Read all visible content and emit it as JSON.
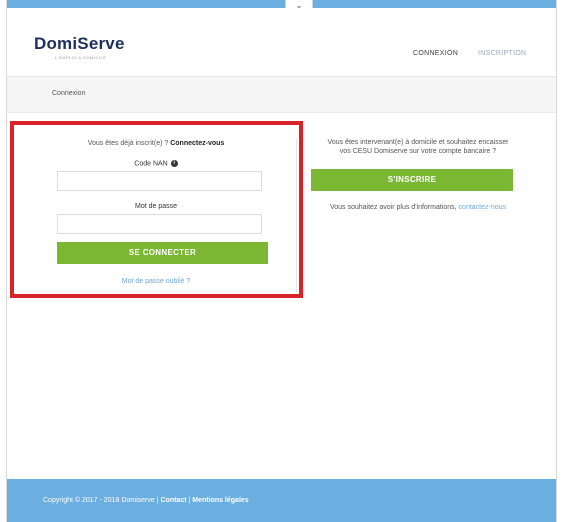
{
  "header": {
    "logo_main": "DomiServe",
    "logo_tagline": "L'EMPLOI A DOMICILE",
    "nav": {
      "connexion": "CONNEXION",
      "inscription": "INSCRIPTION"
    },
    "toggle_glyph": "⌄"
  },
  "subbar": {
    "title": "Connexion"
  },
  "login": {
    "intro_prefix": "Vous êtes déjà inscrit(e) ? ",
    "intro_link": "Connectez-vous",
    "code_label": "Code NAN",
    "info_glyph": "i",
    "code_value": "",
    "password_label": "Mot de passe",
    "password_value": "",
    "submit_label": "SE CONNECTER",
    "forgot_link": "Mot de passe oublié ?"
  },
  "signup": {
    "text_line1": "Vous êtes intervenant(e) à domicile et souhaitez encaisser",
    "text_line2": "vos CESU Domiserve sur votre compte bancaire ?",
    "button_label": "S'INSCRIRE",
    "info_prefix": "Vous souhaitez avoir plus d'informations, ",
    "info_link": "contactez-nous"
  },
  "footer": {
    "copyright": "Copyright © 2017 - 2018 Domiserve | ",
    "contact": "Contact",
    "separator": " | ",
    "legal": "Mentions légales"
  },
  "colors": {
    "accent_blue": "#6baee0",
    "button_green": "#7cb733",
    "highlight_red": "#d92329",
    "link_blue": "#6ea8d8"
  }
}
